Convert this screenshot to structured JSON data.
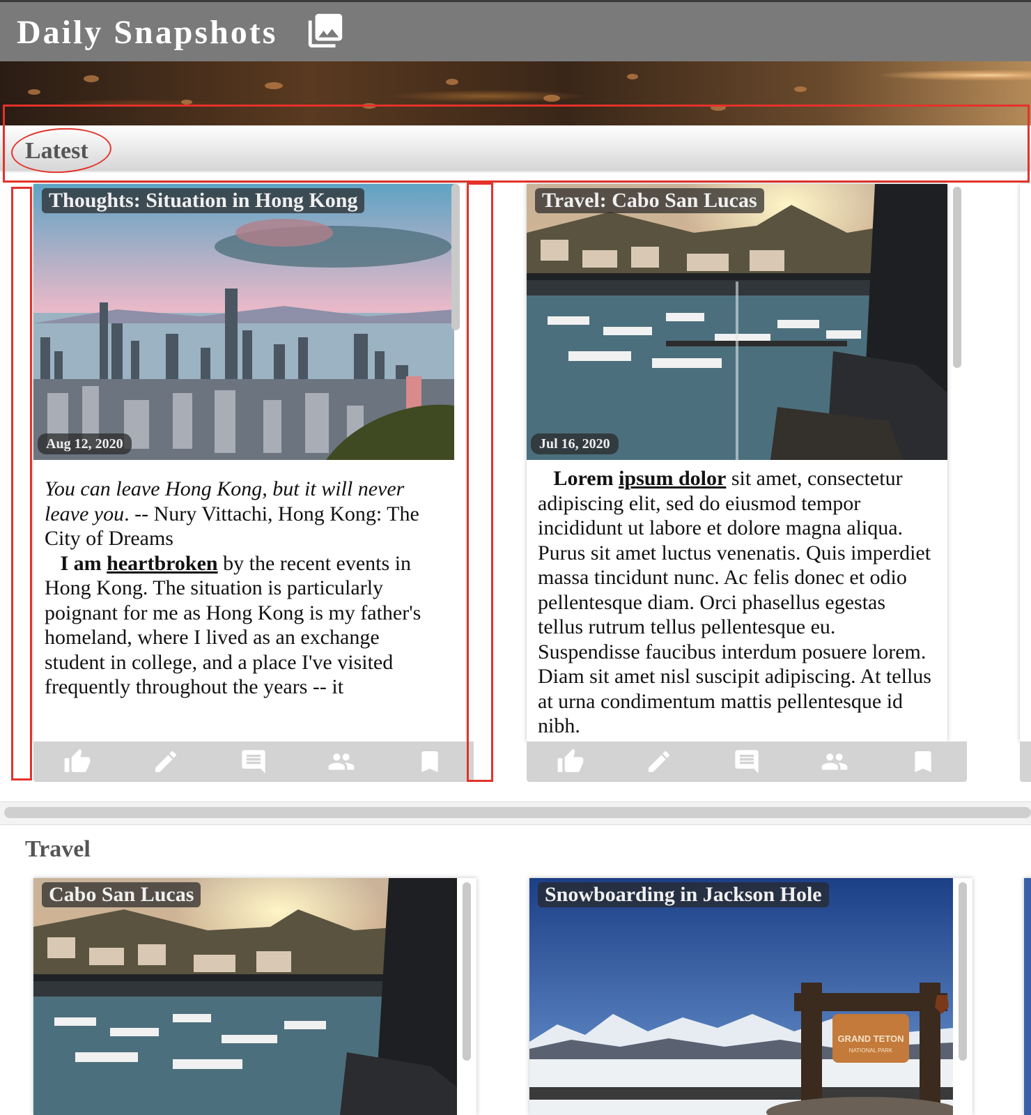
{
  "app": {
    "title": "Daily Snapshots"
  },
  "sections": {
    "latest": {
      "title": "Latest",
      "cards": [
        {
          "title": "Thoughts: Situation in Hong Kong",
          "date": "Aug 12, 2020",
          "quote_italic": "You can leave Hong Kong, but it will never leave you",
          "quote_rest": ". -- Nury Vittachi, Hong Kong: The City of Dreams",
          "body_bold": "I am ",
          "body_link": "heartbroken",
          "body_rest": " by the recent events in Hong Kong. The situation is particularly poignant for me as Hong Kong is my father's homeland, where I lived as an exchange student in college, and a place I've visited frequently throughout the years -- it"
        },
        {
          "title": "Travel: Cabo San Lucas",
          "date": "Jul 16, 2020",
          "body_bold": "Lorem ",
          "body_link": "ipsum dolor",
          "body_rest": " sit amet, consectetur adipiscing elit, sed do eiusmod tempor incididunt ut labore et dolore magna aliqua. Purus sit amet luctus venenatis. Quis imperdiet massa tincidunt nunc. Ac felis donec et odio pellentesque diam. Orci phasellus egestas tellus rutrum tellus pellentesque eu. Suspendisse faucibus interdum posuere lorem. Diam sit amet nisl suscipit adipiscing. At tellus at urna condimentum mattis pellentesque id nibh."
        }
      ]
    },
    "travel": {
      "title": "Travel",
      "cards": [
        {
          "title": "Cabo San Lucas"
        },
        {
          "title": "Snowboarding in Jackson Hole",
          "sign_line1": "GRAND TETON",
          "sign_line2": "NATIONAL PARK"
        }
      ]
    }
  },
  "actions": [
    "thumb-up-icon",
    "pencil-icon",
    "comment-icon",
    "people-icon",
    "bookmark-icon"
  ],
  "colors": {
    "header": "#7a7a7a",
    "annotation": "#e4322b",
    "action_bar": "#d3d3d3"
  }
}
